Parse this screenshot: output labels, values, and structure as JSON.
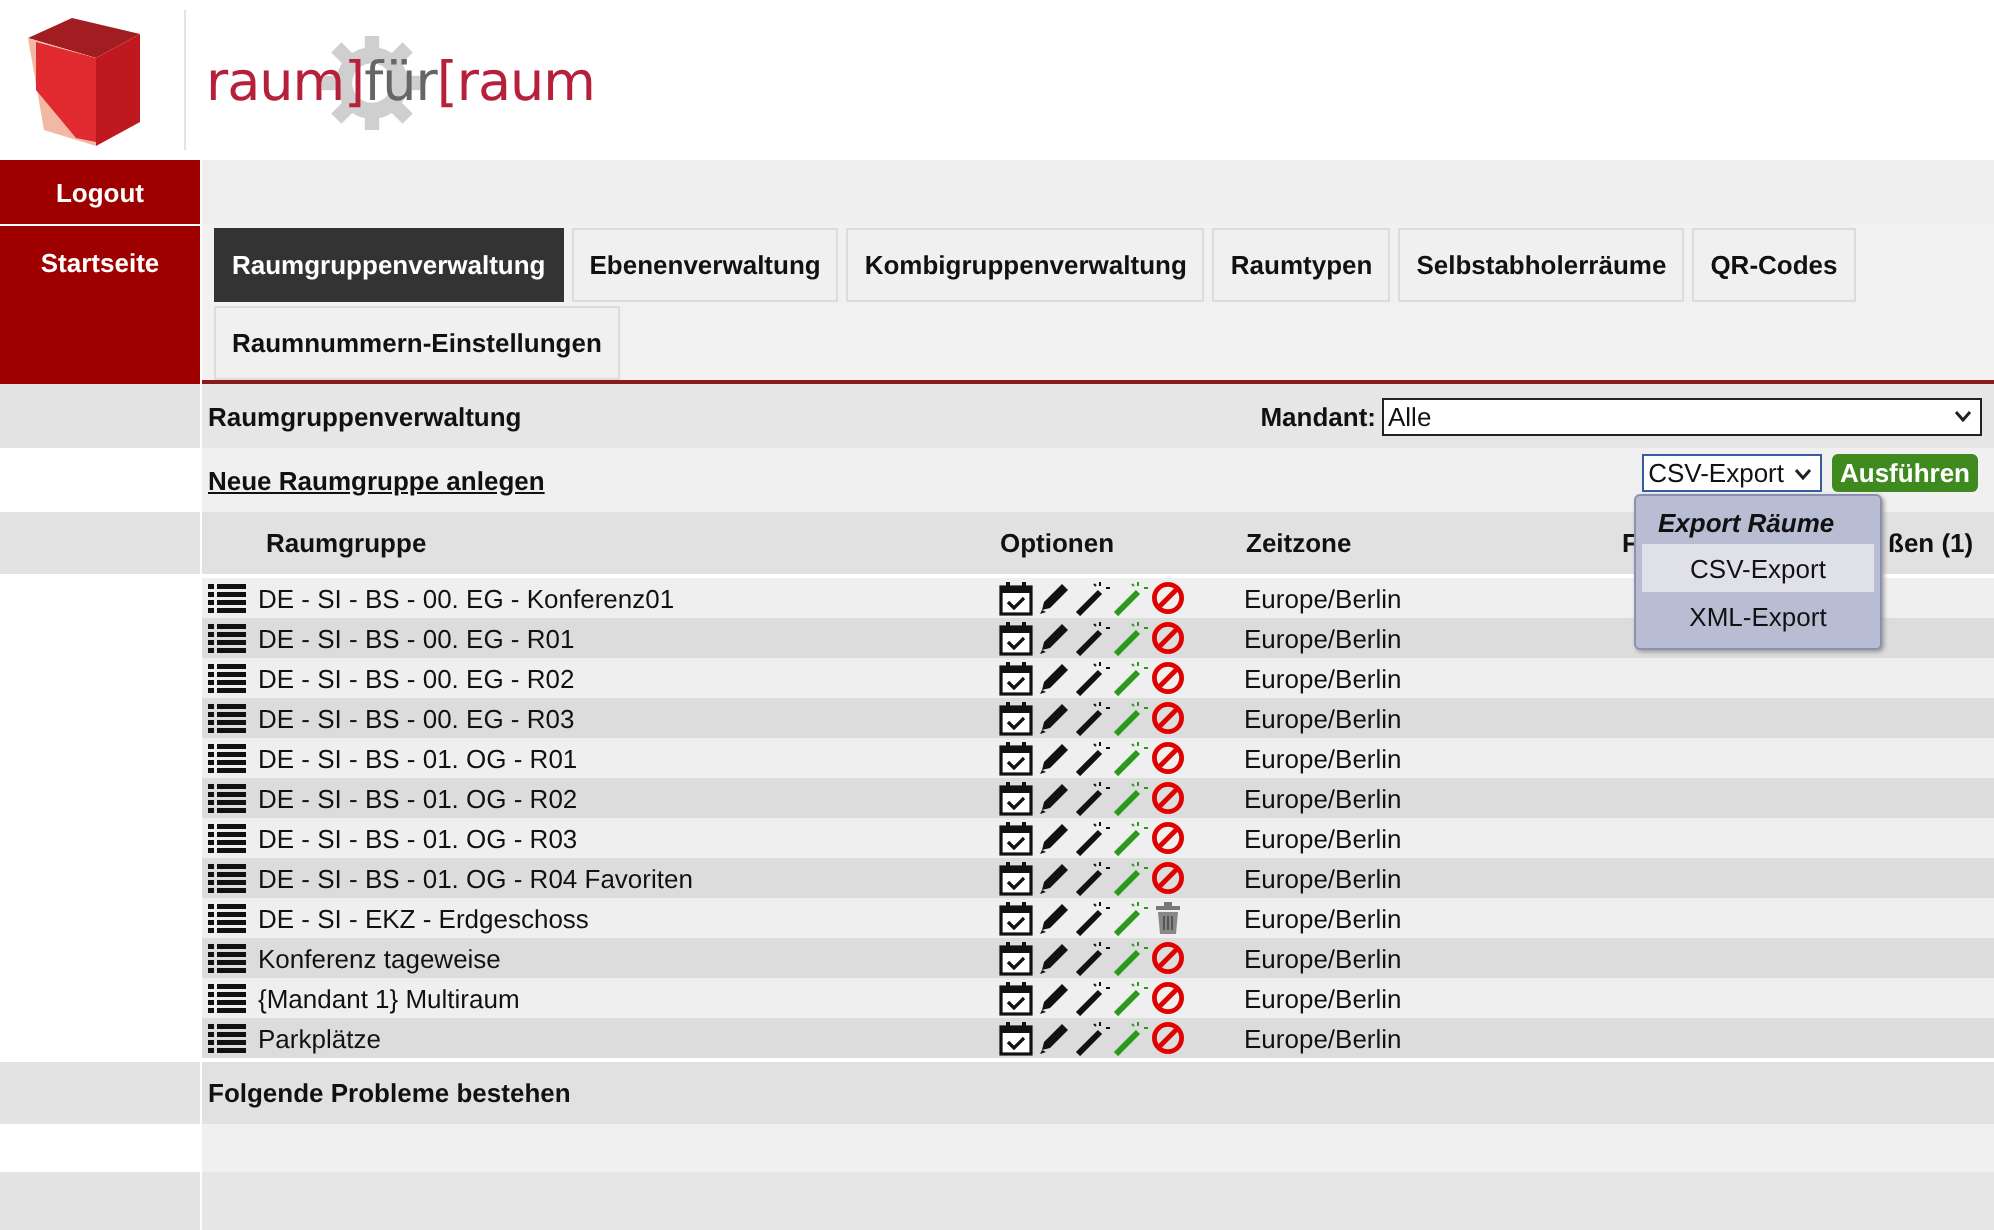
{
  "logo": {
    "wordmark": [
      "raum]",
      "für",
      "[raum"
    ]
  },
  "sidebar": {
    "items": [
      {
        "label": "Logout"
      },
      {
        "label": "Startseite"
      }
    ]
  },
  "tabs": [
    {
      "label": "Raumgruppenverwaltung",
      "selected": true
    },
    {
      "label": "Ebenenverwaltung",
      "selected": false
    },
    {
      "label": "Kombigruppenverwaltung",
      "selected": false
    },
    {
      "label": "Raumtypen",
      "selected": false
    },
    {
      "label": "Selbstabholerräume",
      "selected": false
    },
    {
      "label": "QR-Codes",
      "selected": false
    },
    {
      "label": "Raumnummern-Einstellungen",
      "selected": false
    }
  ],
  "page_title": "Raumgruppenverwaltung",
  "mandant": {
    "label": "Mandant:",
    "value": "Alle"
  },
  "new_link": "Neue Raumgruppe anlegen",
  "export": {
    "value": "CSV-Export",
    "button": "Ausführen",
    "menu": {
      "title": "Export Räume",
      "options": [
        {
          "label": "CSV-Export",
          "selected": true
        },
        {
          "label": "XML-Export",
          "selected": false
        }
      ]
    }
  },
  "table": {
    "columns": [
      "Raumgruppe",
      "Optionen",
      "Zeitzone"
    ],
    "column_4": {
      "start": "F",
      "end": "ßen  (1)"
    },
    "rows": [
      {
        "name": "DE - SI - BS - 00. EG - Konferenz01",
        "zone": "Europe/Berlin",
        "kind": "blockable"
      },
      {
        "name": "DE - SI - BS - 00. EG - R01",
        "zone": "Europe/Berlin",
        "kind": "blockable"
      },
      {
        "name": "DE - SI - BS - 00. EG - R02",
        "zone": "Europe/Berlin",
        "kind": "blockable"
      },
      {
        "name": "DE - SI - BS - 00. EG - R03",
        "zone": "Europe/Berlin",
        "kind": "blockable"
      },
      {
        "name": "DE - SI - BS - 01. OG - R01",
        "zone": "Europe/Berlin",
        "kind": "blockable"
      },
      {
        "name": "DE - SI - BS - 01. OG - R02",
        "zone": "Europe/Berlin",
        "kind": "blockable"
      },
      {
        "name": "DE - SI - BS - 01. OG - R03",
        "zone": "Europe/Berlin",
        "kind": "blockable"
      },
      {
        "name": "DE - SI - BS - 01. OG - R04 Favoriten",
        "zone": "Europe/Berlin",
        "kind": "blockable"
      },
      {
        "name": "DE - SI - EKZ - Erdgeschoss",
        "zone": "Europe/Berlin",
        "kind": "deletable"
      },
      {
        "name": "Konferenz tageweise",
        "zone": "Europe/Berlin",
        "kind": "blockable"
      },
      {
        "name": "{Mandant 1} Multiraum",
        "zone": "Europe/Berlin",
        "kind": "blockable"
      },
      {
        "name": "Parkplätze",
        "zone": "Europe/Berlin",
        "kind": "blockable"
      }
    ]
  },
  "problems_title": "Folgende Probleme bestehen"
}
